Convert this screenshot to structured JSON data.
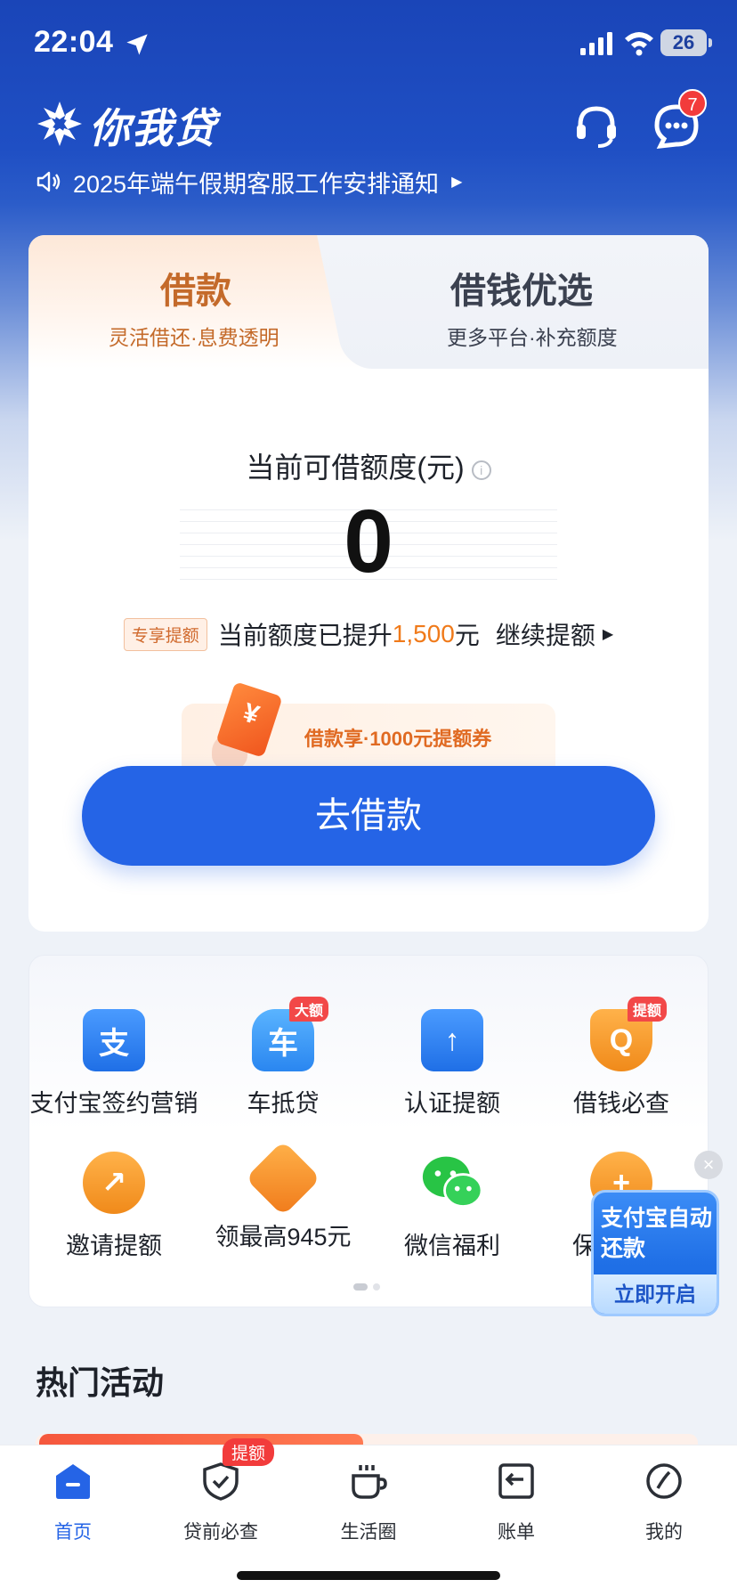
{
  "status_bar": {
    "time": "22:04",
    "battery": "26"
  },
  "header": {
    "logo_text": "你我贷",
    "message_badge": "7"
  },
  "notice": {
    "text": "2025年端午假期客服工作安排通知"
  },
  "loan_card": {
    "tabs": [
      {
        "title": "借款",
        "subtitle": "灵活借还·息费透明"
      },
      {
        "title": "借钱优选",
        "subtitle": "更多平台·补充额度"
      }
    ],
    "limit_label": "当前可借额度(元)",
    "limit_value": "0",
    "raise_tag": "专享提额",
    "raise_text": "当前额度已提升",
    "raise_amount": "1,500",
    "raise_unit": "元",
    "raise_link": "继续提额",
    "coupon_symbol": "¥",
    "coupon_text": "借款享·1000元提额券",
    "borrow_button": "去借款"
  },
  "services": [
    {
      "label": "支付宝签约营销",
      "icon": "alipay-icon",
      "glyph": "支",
      "badge": ""
    },
    {
      "label": "车抵贷",
      "icon": "car-icon",
      "glyph": "车",
      "badge": "大额"
    },
    {
      "label": "认证提额",
      "icon": "upload-arrow-icon",
      "glyph": "↑",
      "badge": ""
    },
    {
      "label": "借钱必查",
      "icon": "search-shield-icon",
      "glyph": "Q",
      "badge": "提额"
    },
    {
      "label": "邀请提额",
      "icon": "heart-arrow-icon",
      "glyph": "↗",
      "badge": ""
    },
    {
      "label": "领最高945元",
      "icon": "gift-card-icon",
      "glyph": "",
      "badge": ""
    },
    {
      "label": "微信福利",
      "icon": "wechat-icon",
      "glyph": "",
      "badge": ""
    },
    {
      "label": "保",
      "icon": "heart-plus-icon",
      "glyph": "+",
      "badge": ""
    }
  ],
  "float_promo": {
    "title": "支付宝自动还款",
    "button": "立即开启",
    "close": "×"
  },
  "hot_section": {
    "title": "热门活动"
  },
  "bottom_nav": [
    {
      "label": "首页",
      "active": true
    },
    {
      "label": "贷前必查",
      "badge": "提额"
    },
    {
      "label": "生活圈"
    },
    {
      "label": "账单"
    },
    {
      "label": "我的"
    }
  ],
  "colors": {
    "brand_blue": "#2564e6",
    "accent_orange": "#f07a1a",
    "badge_red": "#f23b3b"
  }
}
